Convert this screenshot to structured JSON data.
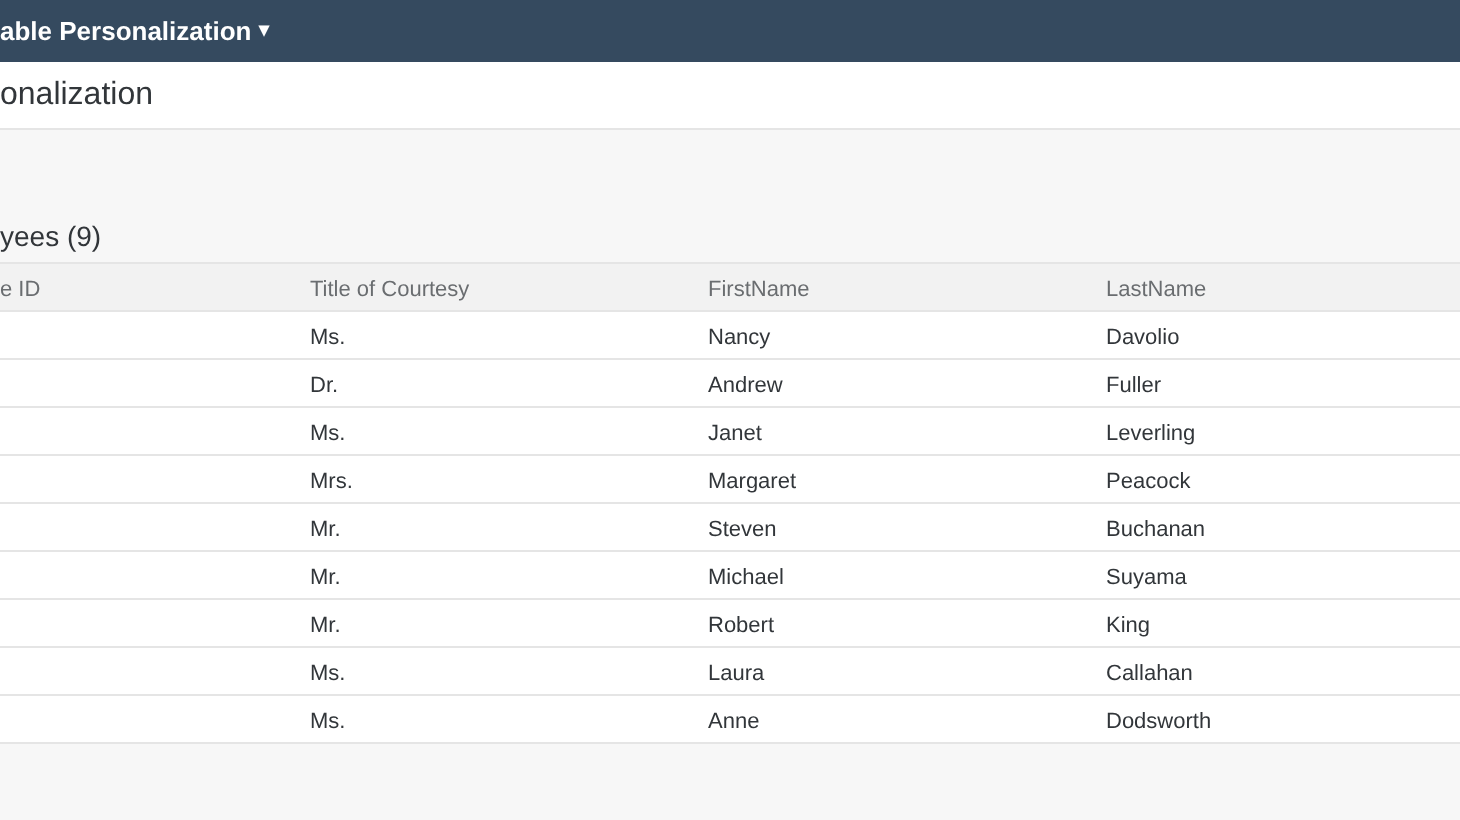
{
  "shell_bar": {
    "title": "able Personalization",
    "menu_icon": "▾"
  },
  "page_title": "onalization",
  "table": {
    "title": "yees (9)",
    "columns": [
      "e ID",
      "Title of Courtesy",
      "FirstName",
      "LastName"
    ],
    "rows": [
      {
        "title": "Ms.",
        "first": "Nancy",
        "last": "Davolio"
      },
      {
        "title": "Dr.",
        "first": "Andrew",
        "last": "Fuller"
      },
      {
        "title": "Ms.",
        "first": "Janet",
        "last": "Leverling"
      },
      {
        "title": "Mrs.",
        "first": "Margaret",
        "last": "Peacock"
      },
      {
        "title": "Mr.",
        "first": "Steven",
        "last": "Buchanan"
      },
      {
        "title": "Mr.",
        "first": "Michael",
        "last": "Suyama"
      },
      {
        "title": "Mr.",
        "first": "Robert",
        "last": "King"
      },
      {
        "title": "Ms.",
        "first": "Laura",
        "last": "Callahan"
      },
      {
        "title": "Ms.",
        "first": "Anne",
        "last": "Dodsworth"
      }
    ]
  }
}
